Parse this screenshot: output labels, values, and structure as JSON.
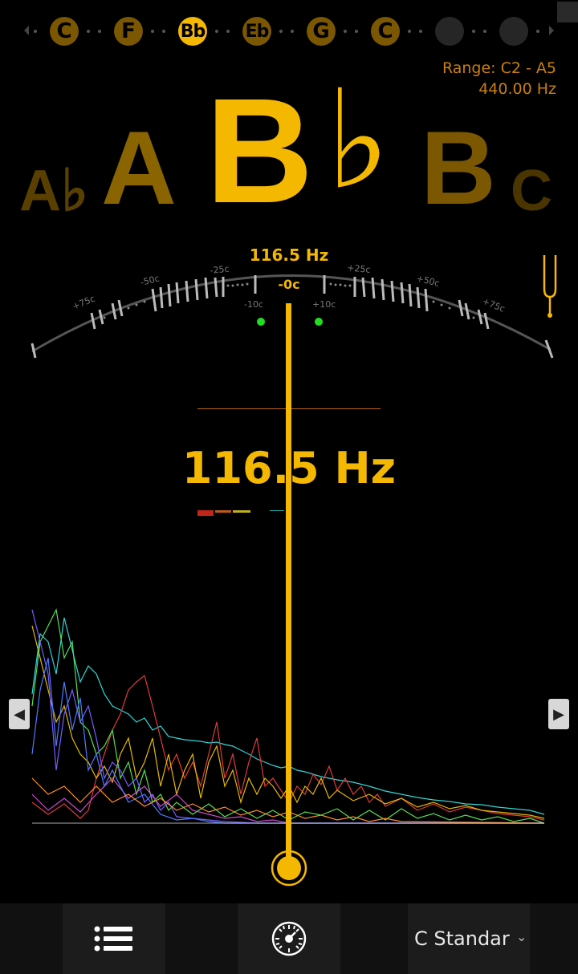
{
  "strings": [
    {
      "label": "C",
      "state": "dim"
    },
    {
      "label": "F",
      "state": "dim"
    },
    {
      "label": "Bb",
      "state": "active"
    },
    {
      "label": "Eb",
      "state": "dim"
    },
    {
      "label": "G",
      "state": "dim"
    },
    {
      "label": "C",
      "state": "dim"
    },
    {
      "label": "",
      "state": "empty"
    },
    {
      "label": "",
      "state": "empty"
    }
  ],
  "range": {
    "line1": "Range: C2 - A5",
    "line2": "440.00 Hz"
  },
  "notes": {
    "far_left": "A♭",
    "left": "A",
    "center": "B",
    "center_accidental": "♭",
    "right": "B",
    "far_right": "C"
  },
  "meter": {
    "frequency": "116.5 Hz",
    "cents": "-0c",
    "scale_labels": [
      "+75c",
      "-50c",
      "-25c",
      "-10c",
      "+10c",
      "+25c",
      "+50c",
      "+75c"
    ],
    "in_tune_indicator_color": "#22dd22"
  },
  "main_frequency": "116.5 Hz",
  "colors": {
    "accent": "#f5b800",
    "dim_accent": "#7a5700",
    "range_text": "#c9800a"
  },
  "icons": {
    "tuning_fork": "tuning-fork-icon",
    "menu": "list-icon",
    "settings": "dial-icon",
    "prev": "left-arrow-icon",
    "next": "right-arrow-icon"
  },
  "bottom": {
    "tuning_name": "C Standar"
  }
}
